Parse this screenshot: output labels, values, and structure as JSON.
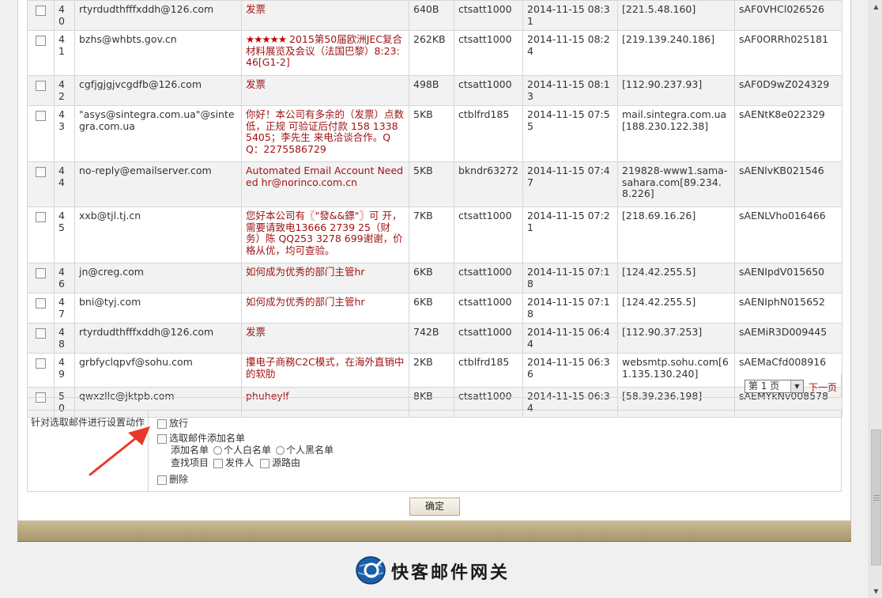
{
  "rows": [
    {
      "num": "40",
      "sender": "rtyrdudthfffxddh@126.com",
      "subject": "发票",
      "size": "640B",
      "account": "ctsatt1000",
      "time": "2014-11-15 08:31",
      "ip": "[221.5.48.160]",
      "id": "sAF0VHCl026526",
      "shade": true
    },
    {
      "num": "41",
      "sender": "bzhs@whbts.gov.cn",
      "stars": "★★★★★",
      "subject": "2015第50届欧洲JEC复合材料展览及会议（法国巴黎）8:23:46[G1-2]",
      "size": "262KB",
      "account": "ctsatt1000",
      "time": "2014-11-15 08:24",
      "ip": "[219.139.240.186]",
      "id": "sAF0ORRh025181",
      "shade": false
    },
    {
      "num": "42",
      "sender": "cgfjgjgjvcgdfb@126.com",
      "subject": "发票",
      "size": "498B",
      "account": "ctsatt1000",
      "time": "2014-11-15 08:13",
      "ip": "[112.90.237.93]",
      "id": "sAF0D9wZ024329",
      "shade": true
    },
    {
      "num": "43",
      "sender": "\"asys@sintegra.com.ua\"@sintegra.com.ua",
      "subject": "你好！本公司有多余的（发票）点数低，正规 可验证后付款 158 1338 5405；李先生 来电洽谈合作。QQ：2275586729",
      "size": "5KB",
      "account": "ctblfrd185",
      "time": "2014-11-15 07:55",
      "ip": "mail.sintegra.com.ua[188.230.122.38]",
      "id": "sAENtK8e022329",
      "shade": false
    },
    {
      "num": "44",
      "sender": "no-reply@emailserver.com",
      "subject": "Automated Email Account Needed hr@norinco.com.cn",
      "size": "5KB",
      "account": "bkndr63272",
      "time": "2014-11-15 07:47",
      "ip": "219828-www1.sama-sahara.com[89.234.8.226]",
      "id": "sAENlvKB021546",
      "shade": true
    },
    {
      "num": "45",
      "sender": "xxb@tjl.tj.cn",
      "subject": "您好本公司有〖\"發&&鏢\"〗可 开，需要请致电13666 2739 25（财务）陈 QQ253 3278 699谢谢，价格从优，均可查验。",
      "size": "7KB",
      "account": "ctsatt1000",
      "time": "2014-11-15 07:21",
      "ip": "[218.69.16.26]",
      "id": "sAENLVho016466",
      "shade": false
    },
    {
      "num": "46",
      "sender": "jn@creg.com",
      "subject": "如何成为优秀的部门主管hr",
      "size": "6KB",
      "account": "ctsatt1000",
      "time": "2014-11-15 07:18",
      "ip": "[124.42.255.5]",
      "id": "sAENIpdV015650",
      "shade": true
    },
    {
      "num": "47",
      "sender": "bni@tyj.com",
      "subject": "如何成为优秀的部门主管hr",
      "size": "6KB",
      "account": "ctsatt1000",
      "time": "2014-11-15 07:18",
      "ip": "[124.42.255.5]",
      "id": "sAENIphN015652",
      "shade": false
    },
    {
      "num": "48",
      "sender": "rtyrdudthfffxddh@126.com",
      "subject": "发票",
      "size": "742B",
      "account": "ctsatt1000",
      "time": "2014-11-15 06:44",
      "ip": "[112.90.37.253]",
      "id": "sAEMiR3D009445",
      "shade": true
    },
    {
      "num": "49",
      "sender": "grbfyclqpvf@sohu.com",
      "subject": "攥电子商務C2C模式，在海外直销中的软肋",
      "size": "2KB",
      "account": "ctblfrd185",
      "time": "2014-11-15 06:36",
      "ip": "websmtp.sohu.com[61.135.130.240]",
      "id": "sAEMaCfd008916",
      "shade": false
    },
    {
      "num": "50",
      "sender": "qwxzllc@jktpb.com",
      "subject": "phuheylf",
      "size": "8KB",
      "account": "ctsatt1000",
      "time": "2014-11-15 06:34",
      "ip": "[58.39.236.198]",
      "id": "sAEMYkNv008578",
      "shade": true
    }
  ],
  "pager": {
    "page": "第 1 页",
    "next": "下一页"
  },
  "actions": {
    "label": "针对选取邮件进行设置动作",
    "release": "放行",
    "add_list": "选取邮件添加名单",
    "add_list_sub": "添加名单",
    "whitelist": "个人白名单",
    "blacklist": "个人黑名单",
    "lookup": "查找项目",
    "sender": "发件人",
    "source_route": "源路由",
    "delete": "删除"
  },
  "confirm_label": "确定",
  "brand_name": "快客邮件网关",
  "colors": {
    "subject": "#a01414",
    "bar": "#b5a47c",
    "arrow": "#e8392a"
  }
}
